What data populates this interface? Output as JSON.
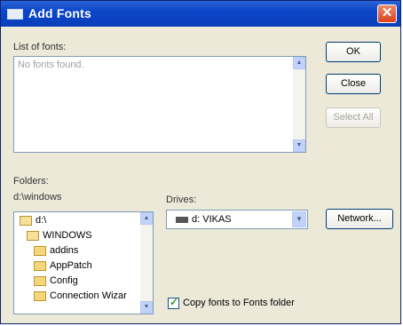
{
  "window": {
    "title": "Add Fonts",
    "close_glyph": "✕"
  },
  "fonts": {
    "label": "List of fonts:",
    "empty_text": "No fonts found."
  },
  "buttons": {
    "ok": "OK",
    "close": "Close",
    "select_all": "Select All",
    "network": "Network..."
  },
  "folders": {
    "label": "Folders:",
    "current_path": "d:\\windows",
    "items": [
      {
        "name": "d:\\",
        "icon": "open-folder-icon",
        "level": 0
      },
      {
        "name": "WINDOWS",
        "icon": "open-folder-icon",
        "level": 1
      },
      {
        "name": "addins",
        "icon": "folder-icon",
        "level": 2
      },
      {
        "name": "AppPatch",
        "icon": "folder-icon",
        "level": 2
      },
      {
        "name": "Config",
        "icon": "folder-icon",
        "level": 2
      },
      {
        "name": "Connection Wizar",
        "icon": "folder-icon",
        "level": 2
      }
    ]
  },
  "drives": {
    "label": "Drives:",
    "selected": "d: VIKAS"
  },
  "copy_option": {
    "label": "Copy fonts to Fonts folder",
    "checked": true
  },
  "colors": {
    "titlebar": "#0a46c8",
    "dialog_bg": "#ece9d8",
    "close_button": "#d8431c"
  }
}
